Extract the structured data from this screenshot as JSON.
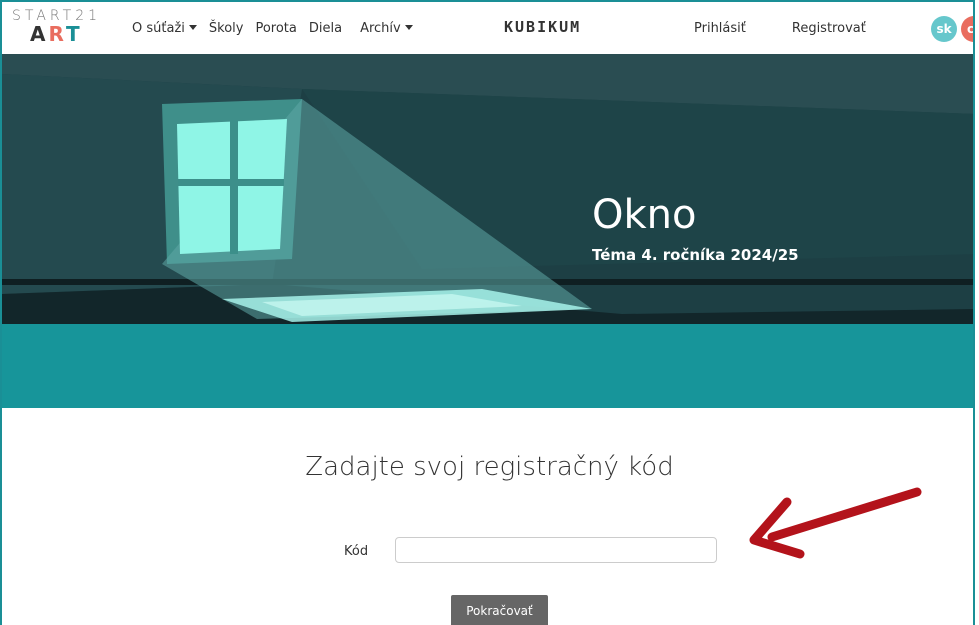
{
  "nav": {
    "logo_top": "START21",
    "logo_art": [
      "A",
      "R",
      "T"
    ],
    "items": [
      {
        "label": "O súťaži",
        "dropdown": true
      },
      {
        "label": "Školy",
        "dropdown": false
      },
      {
        "label": "Porota",
        "dropdown": false
      },
      {
        "label": "Diela",
        "dropdown": false
      },
      {
        "label": "Archív",
        "dropdown": true
      }
    ],
    "brand": "KUBIKUM",
    "login": "Prihlásiť",
    "register": "Registrovať",
    "languages": [
      "sk",
      "cz"
    ]
  },
  "hero": {
    "title": "Okno",
    "subtitle": "Téma 4. ročníka 2024/25"
  },
  "form": {
    "title": "Zadajte svoj registračný kód",
    "code_label": "Kód",
    "code_value": "",
    "submit_label": "Pokračovať"
  },
  "colors": {
    "accent_teal": "#17959a",
    "hero_dark": "#1d3f44",
    "window_glow": "#7fffe8",
    "lang_sk": "#66c7cc",
    "lang_cz": "#e96d5f",
    "arrow": "#b3131b",
    "button": "#666666"
  }
}
